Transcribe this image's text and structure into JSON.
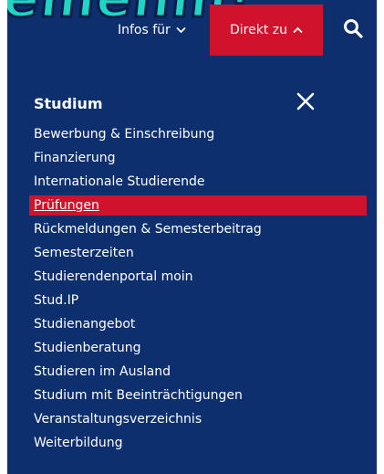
{
  "header": {
    "banner_text": "emehm!",
    "infos_label": "Infos für",
    "direkt_label": "Direkt zu",
    "search_icon": "search-icon",
    "chevron_down_icon": "chevron-down-icon",
    "chevron_up_icon": "chevron-up-icon"
  },
  "menu": {
    "title": "Studium",
    "close_icon": "close-icon",
    "active_index": 3,
    "items": [
      {
        "label": "Bewerbung & Einschreibung"
      },
      {
        "label": "Finanzierung"
      },
      {
        "label": "Internationale Studierende"
      },
      {
        "label": "Prüfungen"
      },
      {
        "label": "Rückmeldungen & Semesterbeitrag"
      },
      {
        "label": "Semesterzeiten"
      },
      {
        "label": "Studierendenportal moin"
      },
      {
        "label": "Stud.IP"
      },
      {
        "label": "Studienangebot"
      },
      {
        "label": "Studienberatung"
      },
      {
        "label": "Studieren im Ausland"
      },
      {
        "label": "Studium mit Beeinträchtigungen"
      },
      {
        "label": "Veranstaltungsverzeichnis"
      },
      {
        "label": "Weiterbildung"
      }
    ]
  },
  "colors": {
    "navy": "#0d2f6e",
    "accent_red": "#d0122c",
    "banner_teal": "#1fd6c4"
  }
}
